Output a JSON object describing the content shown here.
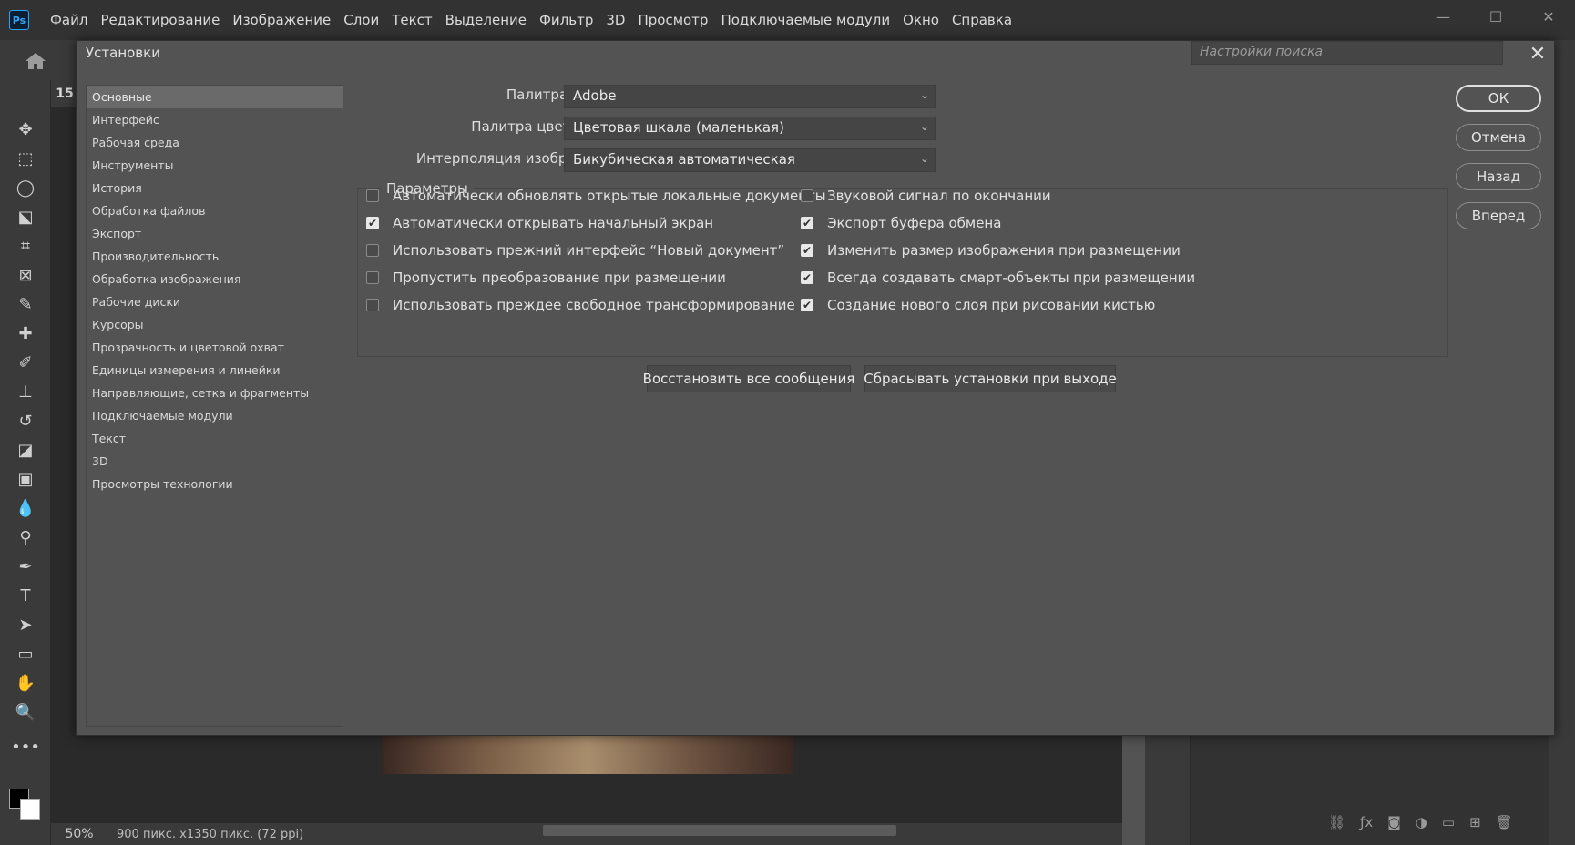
{
  "app": {
    "logo": "Ps"
  },
  "menu": [
    "Файл",
    "Редактирование",
    "Изображение",
    "Слои",
    "Текст",
    "Выделение",
    "Фильтр",
    "3D",
    "Просмотр",
    "Подключаемые модули",
    "Окно",
    "Справка"
  ],
  "window_controls": {
    "minimize": "—",
    "maximize": "☐",
    "close": "✕"
  },
  "document": {
    "tab_label": "15",
    "zoom": "50%",
    "info": "900 пикс. x1350 пикс. (72 ppi)"
  },
  "dialog": {
    "title": "Установки",
    "search_placeholder": "Настройки поиска",
    "categories": [
      "Основные",
      "Интерфейс",
      "Рабочая среда",
      "Инструменты",
      "История",
      "Обработка файлов",
      "Экспорт",
      "Производительность",
      "Обработка изображения",
      "Рабочие диски",
      "Курсоры",
      "Прозрачность и цветовой охват",
      "Единицы измерения и линейки",
      "Направляющие, сетка и фрагменты",
      "Подключаемые модули",
      "Текст",
      "3D",
      "Просмотры технологии"
    ],
    "selected_category": "Основные",
    "fields": {
      "color_picker_label": "Палитра цветов:",
      "color_picker_value": "Adobe",
      "hud_picker_label": "Палитра цветов HUD:",
      "hud_picker_value": "Цветовая шкала (маленькая)",
      "interp_label": "Интерполяция изображения:",
      "interp_value": "Бикубическая автоматическая"
    },
    "params_title": "Параметры",
    "options_left": [
      {
        "label": "Автоматически обновлять открытые локальные документы",
        "checked": false
      },
      {
        "label": "Автоматически открывать начальный экран",
        "checked": true
      },
      {
        "label": "Использовать прежний интерфейс “Новый документ”",
        "checked": false
      },
      {
        "label": "Пропустить преобразование при размещении",
        "checked": false
      },
      {
        "label": "Использовать преждее свободное трансформирование",
        "checked": false
      }
    ],
    "options_right": [
      {
        "label": "Звуковой сигнал по окончании",
        "checked": false
      },
      {
        "label": "Экспорт буфера обмена",
        "checked": true
      },
      {
        "label": "Изменить размер изображения при размещении",
        "checked": true
      },
      {
        "label": "Всегда создавать смарт-объекты при размещении",
        "checked": true
      },
      {
        "label": "Создание нового слоя при рисовании кистью",
        "checked": true
      }
    ],
    "restore_button": "Восстановить все сообщения",
    "reset_button": "Сбрасывать установки при выходе",
    "ok": "ОК",
    "cancel": "Отмена",
    "back": "Назад",
    "forward": "Вперед"
  }
}
